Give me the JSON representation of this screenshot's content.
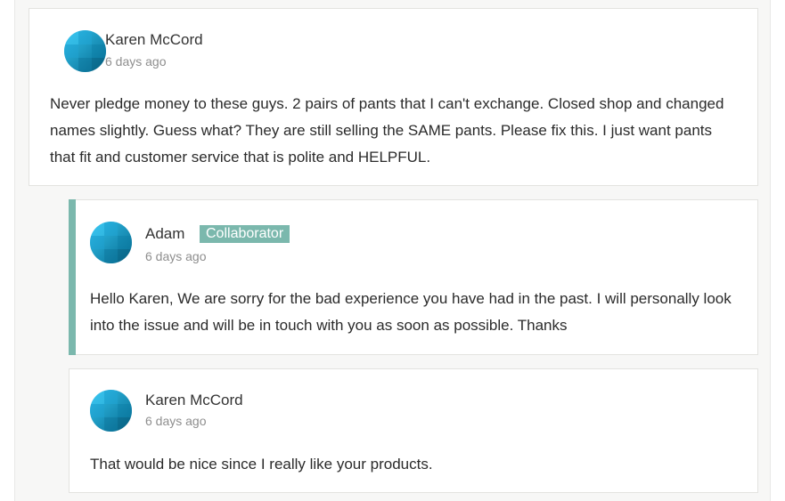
{
  "comments": [
    {
      "author": "Karen McCord",
      "time": "6 days ago",
      "text": "Never pledge money to these guys. 2 pairs of pants that I can't exchange. Closed shop and changed names slightly. Guess what? They are still selling the SAME pants. Please fix this. I just want pants that fit and customer service that is polite and HELPFUL."
    },
    {
      "author": "Adam",
      "badge": "Collaborator",
      "time": "6 days ago",
      "text": "Hello Karen, We are sorry for the bad experience you have had in the past. I will personally look into the issue and will be in touch with you as soon as possible. Thanks"
    },
    {
      "author": "Karen McCord",
      "time": "6 days ago",
      "text": "That would be nice since I really like your products."
    }
  ],
  "colors": {
    "accent": "#7bb8ad",
    "avatar_light": "#29b6e6",
    "avatar_dark": "#0a6f93"
  },
  "icons": {
    "avatar": "avatar-icon"
  }
}
